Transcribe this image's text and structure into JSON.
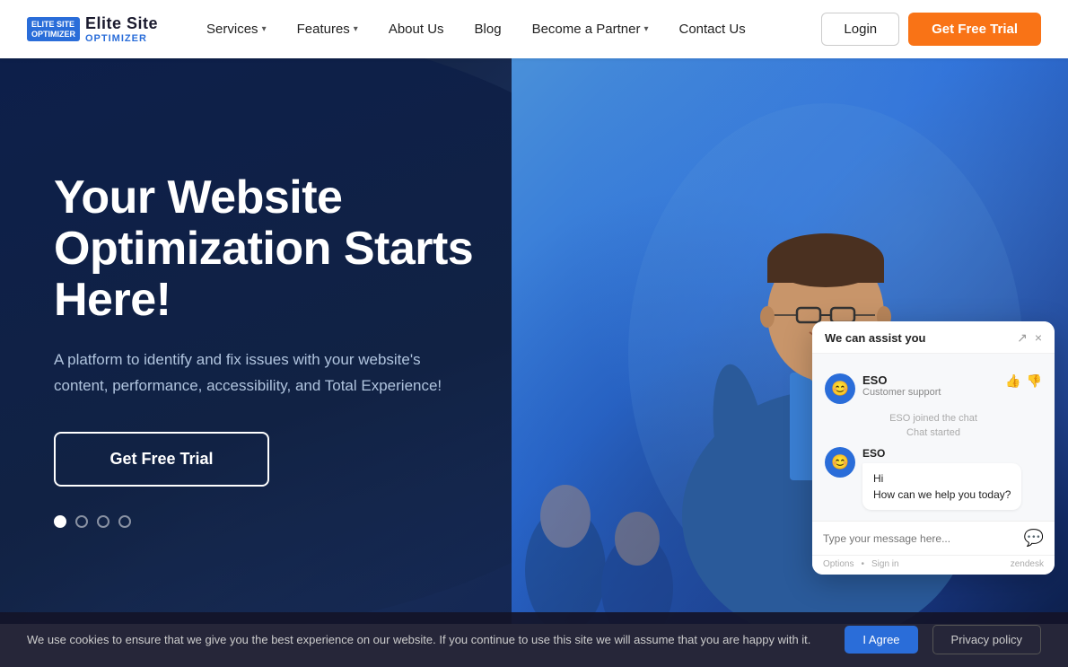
{
  "navbar": {
    "logo": {
      "badge_line1": "ELITE SITE",
      "badge_line2": "OPTIMIZER",
      "text": "Elite Site",
      "subtext": "OPTIMIZER"
    },
    "nav_items": [
      {
        "label": "Services",
        "has_chevron": true
      },
      {
        "label": "Features",
        "has_chevron": true
      },
      {
        "label": "About Us",
        "has_chevron": false
      },
      {
        "label": "Blog",
        "has_chevron": false
      },
      {
        "label": "Become a Partner",
        "has_chevron": true
      },
      {
        "label": "Contact Us",
        "has_chevron": false
      }
    ],
    "login_label": "Login",
    "trial_label": "Get Free Trial"
  },
  "hero": {
    "title": "Your Website Optimization Starts Here!",
    "description": "A platform to identify and fix issues with your website's content, performance, accessibility, and Total Experience!",
    "cta_label": "Get Free Trial",
    "dots": [
      {
        "active": true
      },
      {
        "active": false
      },
      {
        "active": false
      },
      {
        "active": false
      }
    ]
  },
  "chat": {
    "header_text": "We can assist you",
    "expand_icon": "↗",
    "close_icon": "×",
    "agent_name": "ESO",
    "agent_role": "Customer support",
    "system_msg1": "ESO joined the chat",
    "system_msg2": "Chat started",
    "bubble_agent_name": "ESO",
    "bubble_text": "Hi\nHow can we help you today?",
    "input_placeholder": "Type your message here...",
    "footer_options": "Options",
    "footer_signin": "Sign in",
    "powered_by": "zendesk"
  },
  "cookie": {
    "text": "We use cookies to ensure that we give you the best experience on our website. If you continue to use this site we will assume that you are happy with it.",
    "agree_label": "I Agree",
    "privacy_label": "Privacy policy"
  }
}
